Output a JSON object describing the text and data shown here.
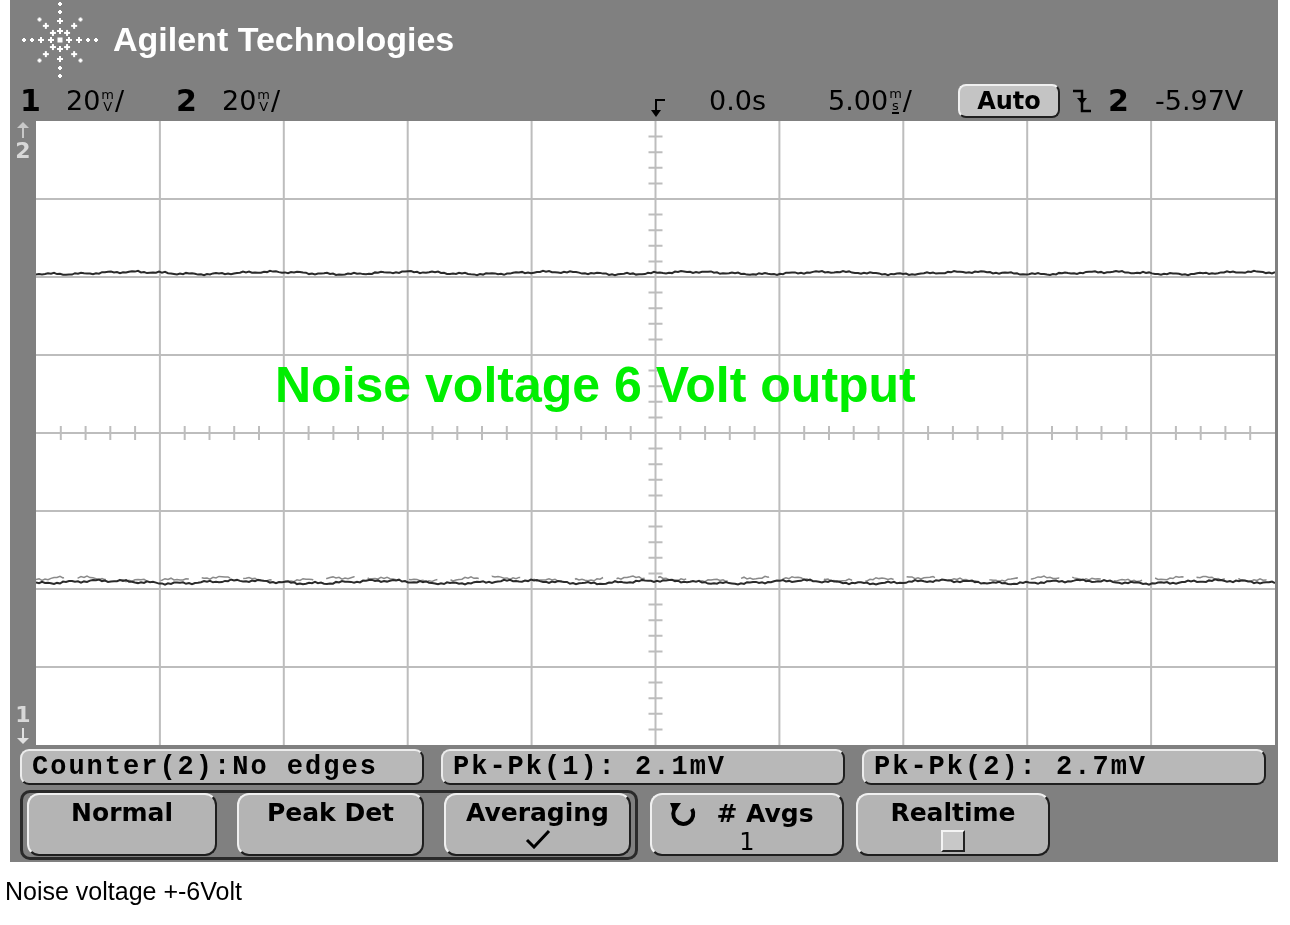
{
  "header": {
    "brand": "Agilent Technologies"
  },
  "status_bar": {
    "channels": [
      {
        "number": "1",
        "value": "20",
        "unit_prefix": "m",
        "unit": "V",
        "suffix": "/"
      },
      {
        "number": "2",
        "value": "20",
        "unit_prefix": "m",
        "unit": "V",
        "suffix": "/"
      }
    ],
    "time_offset": "0.0s",
    "time_scale": {
      "value": "5.00",
      "unit_prefix": "m",
      "unit": "s",
      "suffix": "/"
    },
    "trigger_mode": "Auto",
    "trigger_source": "2",
    "trigger_level": "-5.97V"
  },
  "display": {
    "annotation": "Noise voltage 6 Volt output",
    "ground_markers": [
      {
        "label": "2",
        "kind": "up"
      },
      {
        "label": "1",
        "kind": "down"
      }
    ]
  },
  "measurements": [
    "Counter(2):No edges",
    "Pk-Pk(1): 2.1mV",
    "Pk-Pk(2): 2.7mV"
  ],
  "softkeys": [
    {
      "kind": "radio",
      "label": "Normal",
      "selected": false
    },
    {
      "kind": "radio",
      "label": "Peak Det",
      "selected": false
    },
    {
      "kind": "radio",
      "label": "Averaging",
      "selected": true
    },
    {
      "kind": "value",
      "label": "# Avgs",
      "value": "1"
    },
    {
      "kind": "checkbox",
      "label": "Realtime",
      "checked": false
    }
  ],
  "caption": "Noise voltage +-6Volt"
}
